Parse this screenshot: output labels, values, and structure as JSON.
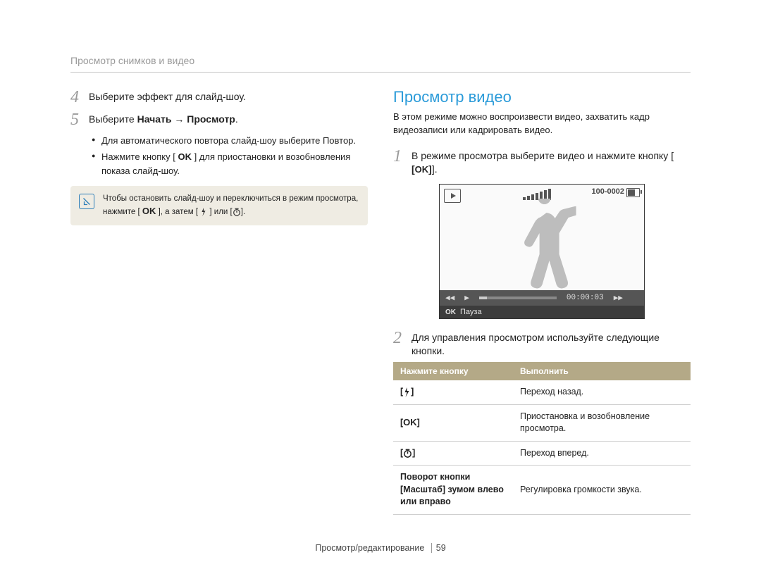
{
  "breadcrumb": "Просмотр снимков и видео",
  "left": {
    "step4_num": "4",
    "step4_text": "Выберите эффект для слайд-шоу.",
    "step5_num": "5",
    "step5_prefix": "Выберите ",
    "step5_bold": "Начать → Просмотр",
    "step5_suffix": ".",
    "bullet1_a": "Для автоматического повтора слайд-шоу выберите ",
    "bullet1_b": "Повтор",
    "bullet1_c": ".",
    "bullet2_a": "Нажмите кнопку [ ",
    "bullet2_ok": "OK",
    "bullet2_b": " ] для приостановки и возобновления показа слайд-шоу.",
    "note_a": "Чтобы остановить слайд-шоу и переключиться в режим просмотра, нажмите [ ",
    "note_ok": "OK",
    "note_b": " ], а затем [ ",
    "note_c": " ] или [",
    "note_d": "]."
  },
  "right": {
    "heading": "Просмотр видео",
    "desc": "В этом режиме можно воспроизвести видео, захватить кадр видеозаписи или кадрировать видео.",
    "step1_num": "1",
    "step1_a": "В режиме просмотра выберите видео и нажмите кнопку [",
    "step1_ok": "OK",
    "step1_b": "].",
    "screen": {
      "file_label": "100-0002",
      "timecode": "00:00:03",
      "pause_label": "Пауза",
      "ok_small": "OK"
    },
    "step2_num": "2",
    "step2_text": "Для управления просмотром используйте следующие кнопки.",
    "table": {
      "head1": "Нажмите кнопку",
      "head2": "Выполнить",
      "row1_action": "Переход назад.",
      "row2_btn_ok": "OK",
      "row2_action": "Приостановка и возобновление просмотра.",
      "row3_action": "Переход вперед.",
      "row4_btn": "Поворот кнопки [Масштаб] зумом влево или вправо",
      "row4_action": "Регулировка громкости звука."
    }
  },
  "footer": {
    "section": "Просмотр/редактирование",
    "page": "59"
  }
}
